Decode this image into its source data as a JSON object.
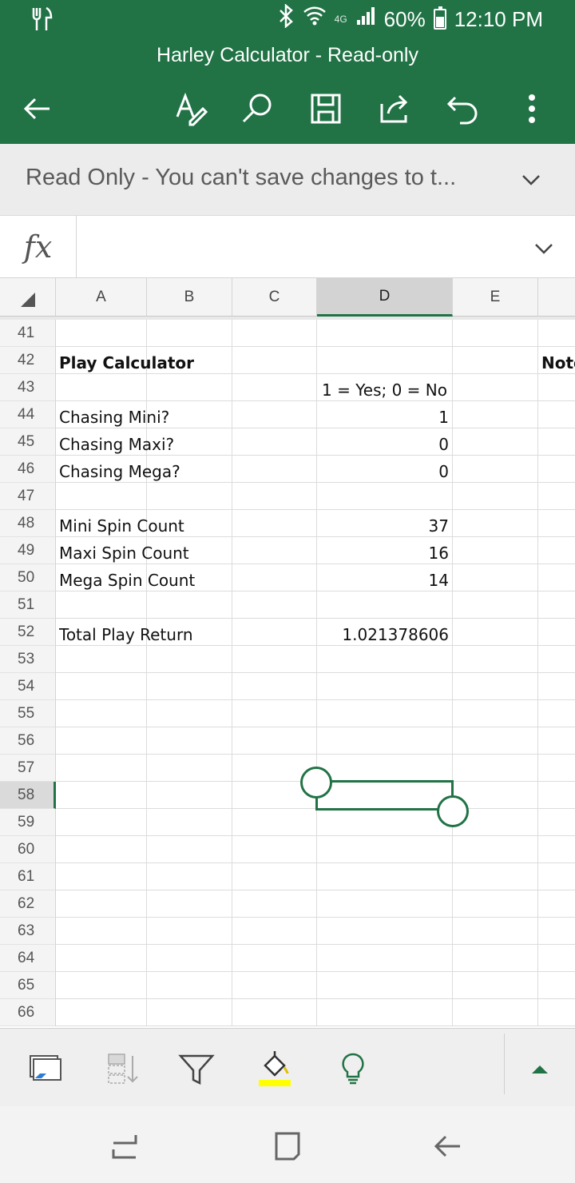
{
  "status_bar": {
    "left_icon": "restaurant-icon",
    "network": "4G",
    "battery": "60%",
    "time": "12:10 PM"
  },
  "title_bar": {
    "title": "Harley Calculator - Read-only",
    "icons": [
      "back-arrow-icon",
      "pen-icon",
      "search-icon",
      "save-icon",
      "share-icon",
      "undo-icon",
      "more-icon"
    ]
  },
  "banner": {
    "text": "Read Only - You can't save changes to t..."
  },
  "formula_bar": {
    "label": "fx",
    "value": ""
  },
  "grid": {
    "columns": [
      "A",
      "B",
      "C",
      "D",
      "E"
    ],
    "selected_column": "D",
    "rows": [
      "41",
      "42",
      "43",
      "44",
      "45",
      "46",
      "47",
      "48",
      "49",
      "50",
      "51",
      "52",
      "53",
      "54",
      "55",
      "56",
      "57",
      "58",
      "59",
      "60",
      "61",
      "62",
      "63",
      "64",
      "65",
      "66"
    ],
    "selected_row": "58",
    "cells": {
      "r42_a": "Play Calculator",
      "r42_f": "Notes",
      "r43_d": "1 = Yes; 0 = No",
      "r44_a": "Chasing Mini?",
      "r44_d": "1",
      "r45_a": "Chasing Maxi?",
      "r45_d": "0",
      "r46_a": "Chasing Mega?",
      "r46_d": "0",
      "r48_a": "Mini Spin Count",
      "r48_d": "37",
      "r49_a": "Maxi Spin Count",
      "r49_d": "16",
      "r50_a": "Mega Spin Count",
      "r50_d": "14",
      "r52_a": "Total Play Return",
      "r52_d": "1.021378606"
    }
  },
  "toolbar": {
    "icons": [
      "freeze-panes-icon",
      "sort-icon",
      "filter-icon",
      "fill-color-icon",
      "tell-me-icon",
      "expand-up-icon"
    ],
    "fill_color": "#ffff00"
  },
  "nav_bar": {
    "icons": [
      "recent-apps-icon",
      "home-icon",
      "back-icon"
    ]
  },
  "colors": {
    "accent": "#217346"
  }
}
